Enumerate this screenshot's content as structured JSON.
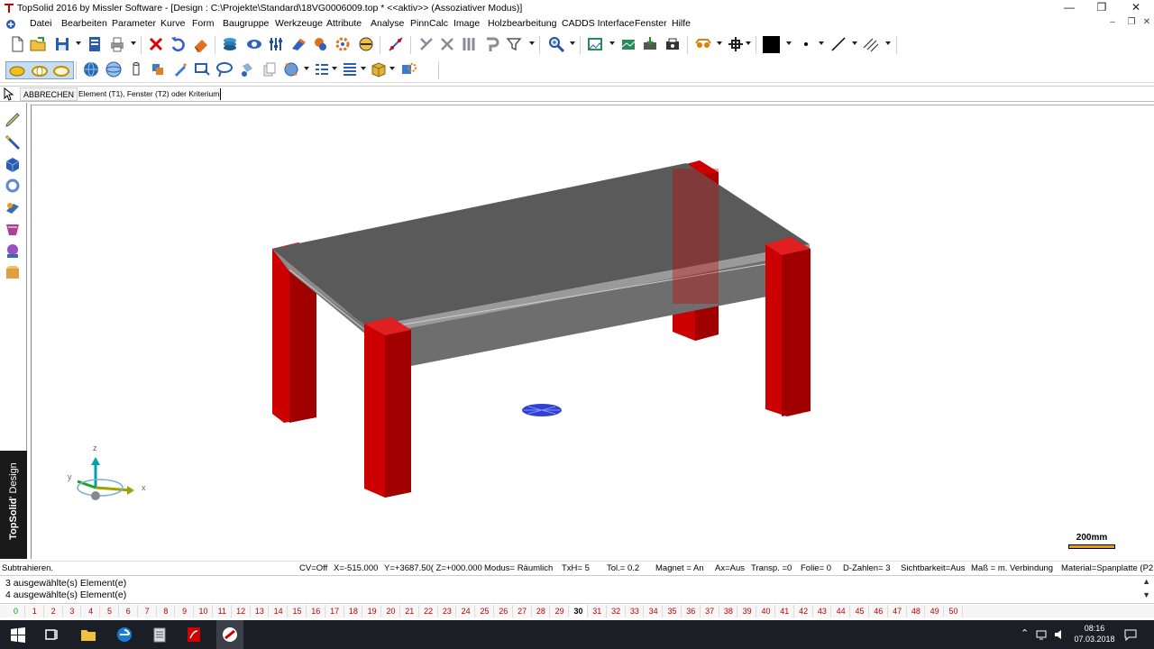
{
  "window": {
    "title": "TopSolid 2016 by Missler Software - [Design : C:\\Projekte\\Standard\\18VG0006009.top * <<aktiv>> (Assoziativer Modus)]",
    "minimize": "—",
    "maximize": "❐",
    "close": "✕"
  },
  "menu": {
    "items": [
      "Datei",
      "Bearbeiten",
      "Parameter",
      "Kurve",
      "Form",
      "Baugruppe",
      "Werkzeuge",
      "Attribute",
      "Analyse",
      "PinnCalc",
      "Image",
      "Holzbearbeitung",
      "CADDS Interface",
      "Fenster",
      "Hilfe"
    ],
    "doc_minimize": "–",
    "doc_restore": "❐",
    "doc_close": "✕"
  },
  "toolbar1": {
    "icons": [
      "new-document-icon",
      "open-folder-icon",
      "save-icon",
      "properties-icon",
      "print-icon",
      "delete-icon",
      "undo-icon",
      "eraser-icon",
      "layers-icon",
      "view-options-icon",
      "parameters-icon",
      "sweep-icon",
      "repair-icon",
      "gear-icon",
      "curve-tool-icon",
      "distance-icon",
      "trim-icon",
      "cut-icon",
      "columns-icon",
      "hook-icon",
      "filter-icon",
      "zoom-icon",
      "zoom-window-icon",
      "image-icon",
      "export-icon",
      "printer-icon",
      "glasses-icon",
      "crosshair-icon",
      "color-swatch-icon",
      "point-style-icon",
      "line-style-icon",
      "hatch-icon"
    ],
    "accent_color": "#000000"
  },
  "toolbar2": {
    "icons": [
      "shape-solid-icon",
      "shape-outline-icon",
      "shape-wire-icon",
      "globe-icon",
      "sphere-icon",
      "cylinder-icon",
      "layers-stack-icon",
      "pen-icon",
      "rectangle-select-icon",
      "lasso-icon",
      "paint-icon",
      "copy-icon",
      "globe-arrows-icon",
      "grid-list-icon",
      "list-lines-icon",
      "box-dropdown-icon",
      "settings-cube-icon"
    ]
  },
  "command": {
    "cancel_label": "ABBRECHEN",
    "prompt": "Element (T1), Fenster (T2) oder Kriterium:",
    "input_value": ""
  },
  "left_tools": [
    "sketch-pencil-icon",
    "curve-pen-icon",
    "solid-box-icon",
    "rotate-icon",
    "wood-icon",
    "measure-icon",
    "render-icon",
    "package-icon"
  ],
  "brand": {
    "name": "TopSolid",
    "module": "' Design"
  },
  "viewport": {
    "axis_labels": {
      "z": "z",
      "y": "y",
      "x": "x"
    },
    "scale_label": "200mm",
    "leg_color": "#cc0000",
    "top_color": "#606060"
  },
  "status": {
    "mode": "Subtrahieren.",
    "cv": "CV=Off",
    "x": "X=-515.000",
    "y": "Y=+3687.50( Z=+000.000",
    "modus": "Modus= Räumlich",
    "txh": "TxH= 5",
    "tol": "Tol.= 0.2",
    "magnet": "Magnet = An",
    "ax": "Ax=Aus",
    "transp": "Transp. =0",
    "folie": "Folie= 0",
    "dzahlen": "D-Zahlen= 3",
    "sicht": "Sichtbarkeit=Aus",
    "mass": "Maß = m. Verbindung",
    "material": "Material=Spanplatte (P2"
  },
  "messages": [
    "3 ausgewählte(s) Element(e)",
    "4 ausgewählte(s) Element(e)"
  ],
  "layers": {
    "items": [
      "0",
      "1",
      "2",
      "3",
      "4",
      "5",
      "6",
      "7",
      "8",
      "9",
      "10",
      "11",
      "12",
      "13",
      "14",
      "15",
      "16",
      "17",
      "18",
      "19",
      "20",
      "21",
      "22",
      "23",
      "24",
      "25",
      "26",
      "27",
      "28",
      "29",
      "30",
      "31",
      "32",
      "33",
      "34",
      "35",
      "36",
      "37",
      "38",
      "39",
      "40",
      "41",
      "42",
      "43",
      "44",
      "45",
      "46",
      "47",
      "48",
      "49",
      "50"
    ],
    "active": "30"
  },
  "taskbar": {
    "time": "08:16",
    "date": "07.03.2018"
  }
}
